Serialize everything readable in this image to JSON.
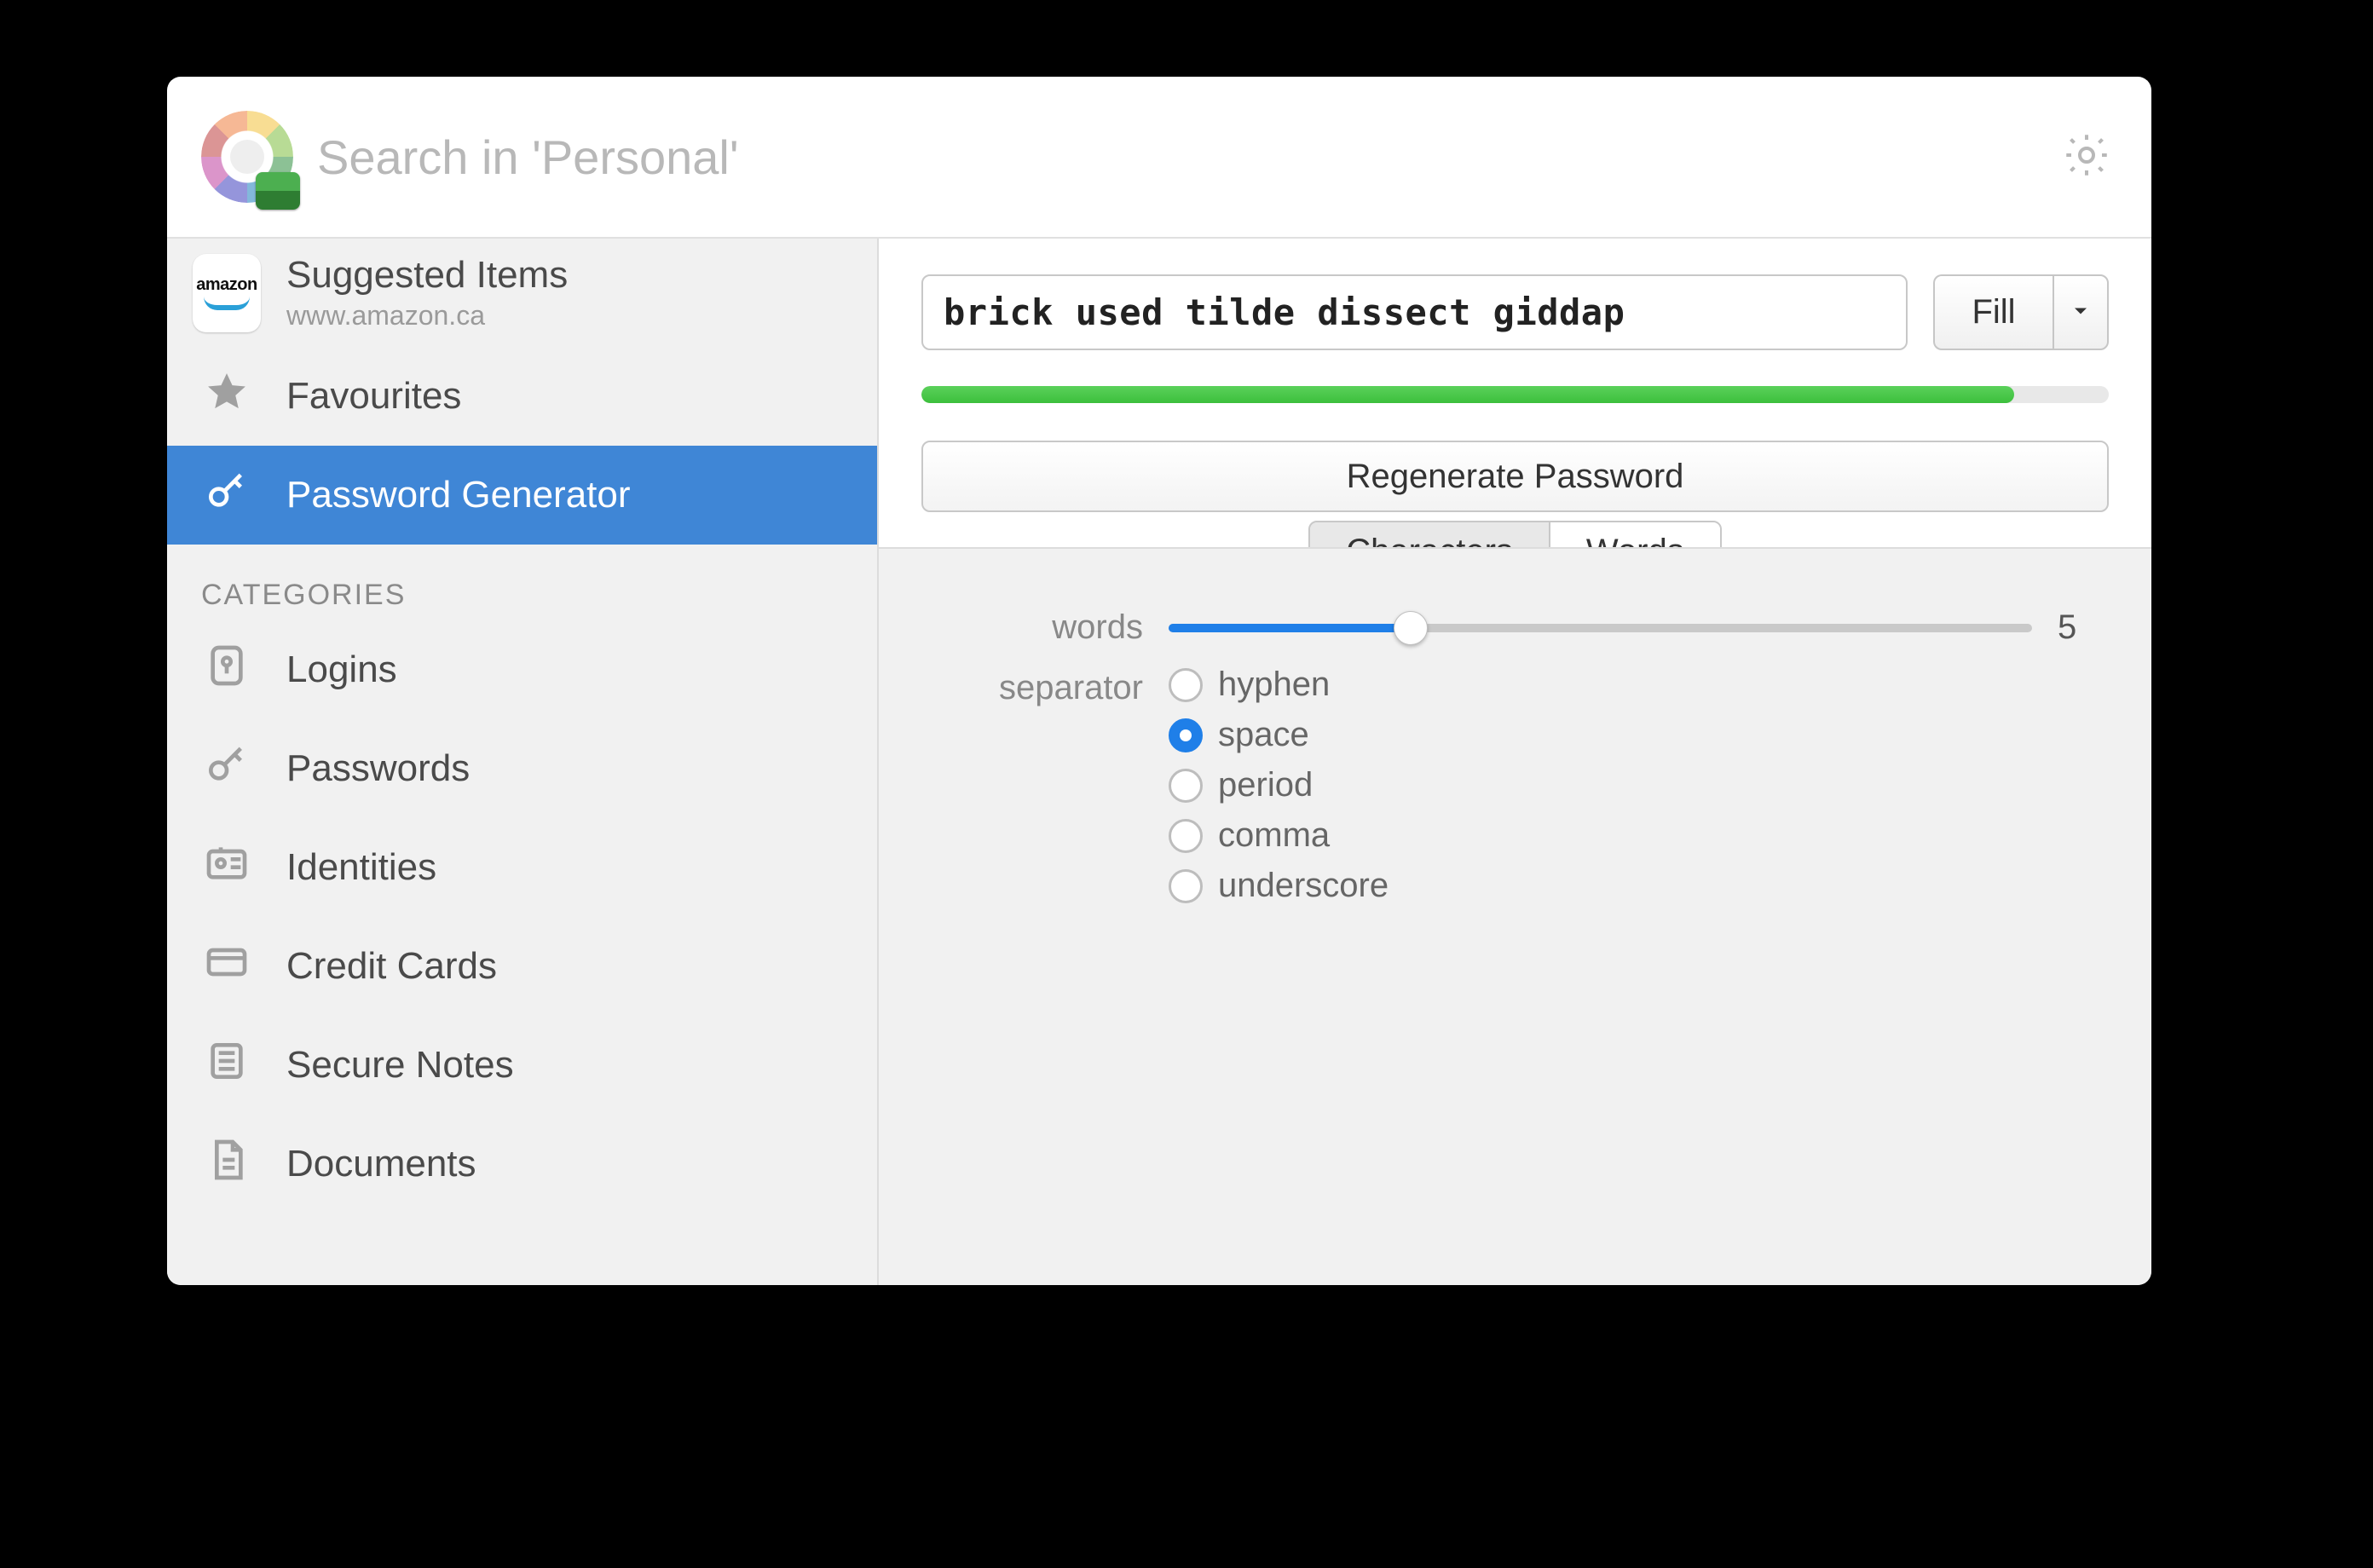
{
  "header": {
    "search_placeholder": "Search in 'Personal'"
  },
  "sidebar": {
    "suggested": {
      "title": "Suggested Items",
      "subtitle": "www.amazon.ca"
    },
    "favourites_label": "Favourites",
    "generator_label": "Password Generator",
    "categories_heading": "CATEGORIES",
    "categories": {
      "logins": "Logins",
      "passwords": "Passwords",
      "identities": "Identities",
      "credit_cards": "Credit Cards",
      "secure_notes": "Secure Notes",
      "documents": "Documents"
    }
  },
  "generator": {
    "password_value": "brick used tilde dissect giddap",
    "fill_label": "Fill",
    "strength_percent": 92,
    "regenerate_label": "Regenerate Password",
    "tabs": {
      "characters": "Characters",
      "words": "Words",
      "selected": "words"
    },
    "words": {
      "label": "words",
      "value": "5",
      "slider_percent": 28
    },
    "separator": {
      "label": "separator",
      "selected": "space",
      "options": {
        "hyphen": "hyphen",
        "space": "space",
        "period": "period",
        "comma": "comma",
        "underscore": "underscore"
      }
    }
  }
}
